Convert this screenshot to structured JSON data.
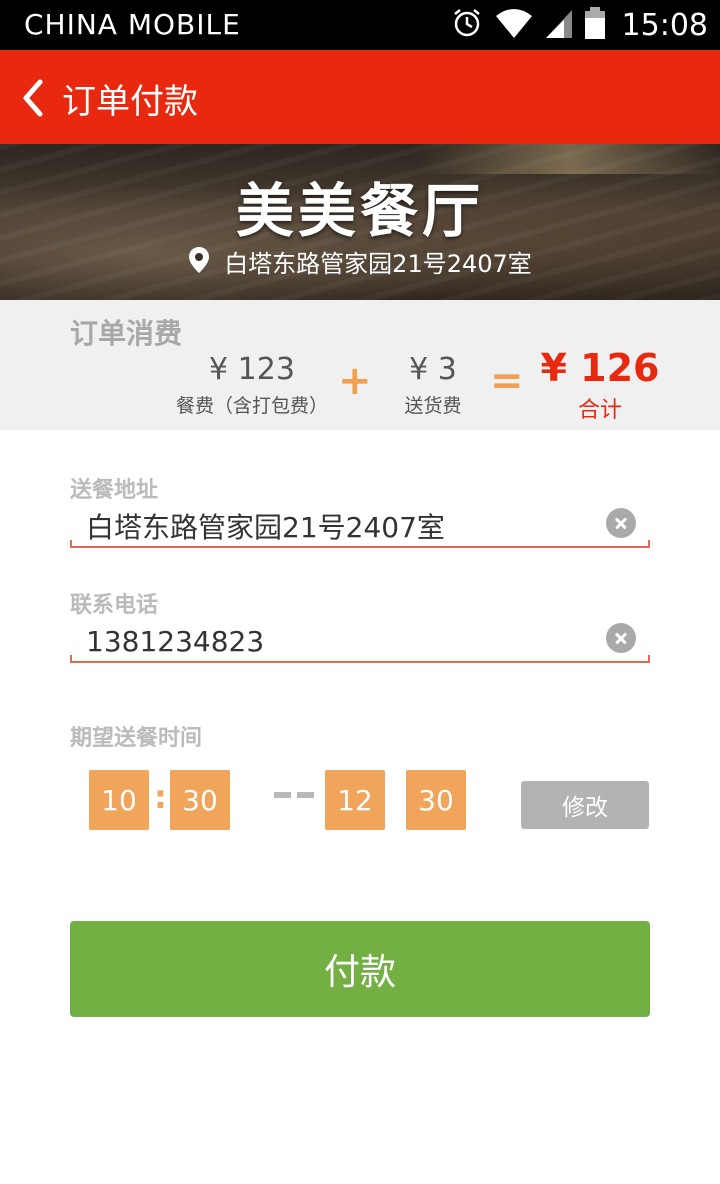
{
  "status_bar": {
    "carrier": "CHINA  MOBILE",
    "time": "15:08",
    "icons": [
      "alarm-icon",
      "wifi-icon",
      "signal-icon",
      "battery-icon"
    ]
  },
  "header": {
    "title": "订单付款",
    "back_icon": "chevron-left-icon",
    "color": "#e8290f"
  },
  "restaurant": {
    "name": "美美餐厅",
    "address": "白塔东路管家园21号2407室",
    "location_icon": "map-pin-icon"
  },
  "order_summary": {
    "title": "订单消费",
    "food_fee": {
      "value": "¥  123",
      "label": "餐费（含打包费）"
    },
    "plus": "+",
    "delivery_fee": {
      "value": "¥ 3",
      "label": "送货费"
    },
    "equals": "=",
    "total": {
      "value": "¥ 126",
      "label": "合计"
    }
  },
  "form": {
    "address": {
      "label": "送餐地址",
      "value": "白塔东路管家园21号2407室"
    },
    "phone": {
      "label": "联系电话",
      "value": "1381234823"
    },
    "delivery_time": {
      "label": "期望送餐时间",
      "start_hour": "10",
      "colon": ":",
      "start_minute": "30",
      "end_hour": "12",
      "end_minute": "30",
      "modify_label": "修改"
    }
  },
  "pay_button": {
    "label": "付款",
    "color": "#72b043"
  },
  "colors": {
    "accent": "#e8290f",
    "time_box": "#f0a55a",
    "field_line": "#e36850"
  }
}
